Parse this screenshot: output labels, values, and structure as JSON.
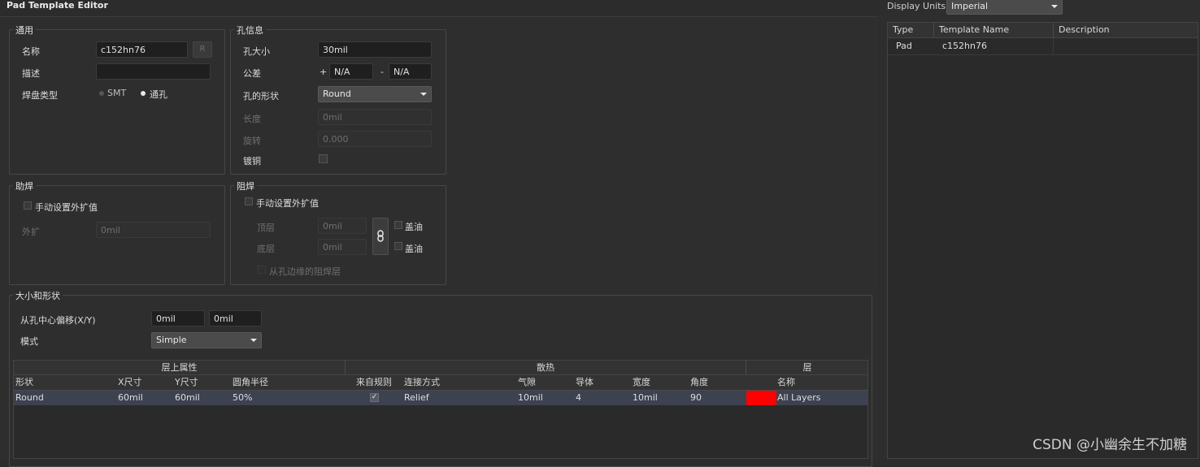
{
  "window_title": "Pad Template Editor",
  "general": {
    "title": "通用",
    "name_label": "名称",
    "name_value": "c152hn76",
    "r_button": "R",
    "desc_label": "描述",
    "desc_value": "",
    "padtype_label": "焊盘类型",
    "smt_label": "SMT",
    "through_label": "通孔"
  },
  "hole": {
    "title": "孔信息",
    "size_label": "孔大小",
    "size_value": "30mil",
    "tolerance_label": "公差",
    "plus": "+",
    "plus_value": "N/A",
    "minus": "-",
    "minus_value": "N/A",
    "shape_label": "孔的形状",
    "shape_value": "Round",
    "length_label": "长度",
    "length_value": "0mil",
    "rotation_label": "旋转",
    "rotation_value": "0.000",
    "plated_label": "镀铜"
  },
  "paste": {
    "title": "助焊",
    "manual_label": "手动设置外扩值",
    "expand_label": "外扩",
    "expand_value": "0mil"
  },
  "solder": {
    "title": "阻焊",
    "manual_label": "手动设置外扩值",
    "top_label": "顶层",
    "top_value": "0mil",
    "bottom_label": "底层",
    "bottom_value": "0mil",
    "tent_top_label": "盖油",
    "tent_bottom_label": "盖油",
    "from_hole_label": "从孔边缘的阻焊层"
  },
  "size_shape": {
    "title": "大小和形状",
    "offset_label": "从孔中心偏移(X/Y)",
    "offset_x": "0mil",
    "offset_y": "0mil",
    "mode_label": "模式",
    "mode_value": "Simple"
  },
  "table": {
    "group_headers": [
      "层上属性",
      "散热",
      "层"
    ],
    "columns": [
      "形状",
      "X尺寸",
      "Y尺寸",
      "圆角半径",
      "来自规则",
      "连接方式",
      "气隙",
      "导体",
      "宽度",
      "角度",
      "名称"
    ],
    "rows": [
      {
        "shape": "Round",
        "x": "60mil",
        "y": "60mil",
        "radius": "50%",
        "from_rule": true,
        "conn": "Relief",
        "gap": "10mil",
        "conductor": "4",
        "width": "10mil",
        "angle": "90",
        "layer_color": "#ff0000",
        "layer_name": "All Layers"
      }
    ]
  },
  "right": {
    "display_units_label": "Display Units",
    "display_units_value": "Imperial",
    "columns": [
      "Type",
      "Template Name",
      "Description"
    ],
    "rows": [
      {
        "type": "Pad",
        "name": "c152hn76",
        "desc": ""
      }
    ]
  },
  "watermark": "CSDN @小幽余生不加糖"
}
